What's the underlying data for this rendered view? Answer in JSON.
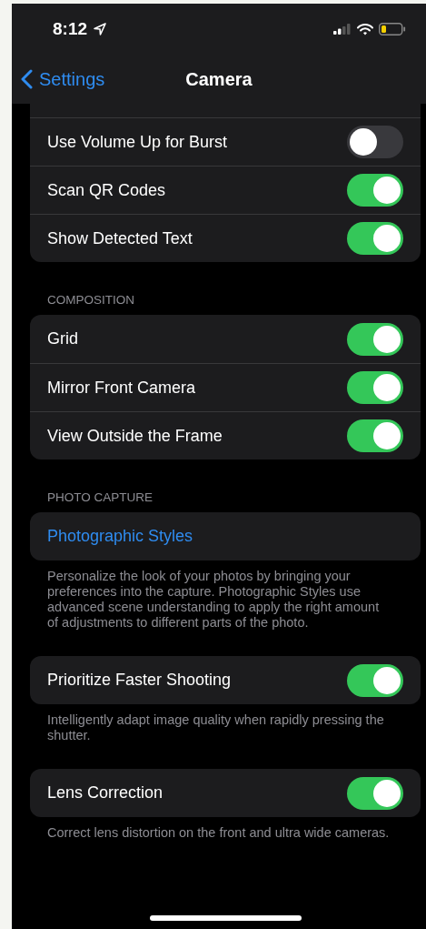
{
  "status_bar": {
    "time": "8:12"
  },
  "nav": {
    "back": "Settings",
    "title": "Camera"
  },
  "sections": [
    {
      "cut_top": true,
      "rows": [
        {
          "kind": "toggle",
          "label": "Use Volume Up for Burst",
          "on": false
        },
        {
          "kind": "toggle",
          "label": "Scan QR Codes",
          "on": true
        },
        {
          "kind": "toggle",
          "label": "Show Detected Text",
          "on": true
        }
      ]
    },
    {
      "header": "COMPOSITION",
      "rows": [
        {
          "kind": "toggle",
          "label": "Grid",
          "on": true
        },
        {
          "kind": "toggle",
          "label": "Mirror Front Camera",
          "on": true
        },
        {
          "kind": "toggle",
          "label": "View Outside the Frame",
          "on": true
        }
      ]
    },
    {
      "header": "PHOTO CAPTURE",
      "rows": [
        {
          "kind": "link",
          "label": "Photographic Styles"
        }
      ],
      "footer": "Personalize the look of your photos by bringing your preferences into the capture. Photographic Styles use advanced scene understanding to apply the right amount of adjustments to different parts of the photo."
    },
    {
      "rows": [
        {
          "kind": "toggle",
          "label": "Prioritize Faster Shooting",
          "on": true
        }
      ],
      "footer": "Intelligently adapt image quality when rapidly pressing the shutter."
    },
    {
      "rows": [
        {
          "kind": "toggle",
          "label": "Lens Correction",
          "on": true
        }
      ],
      "footer": "Correct lens distortion on the front and ultra wide cameras."
    }
  ]
}
